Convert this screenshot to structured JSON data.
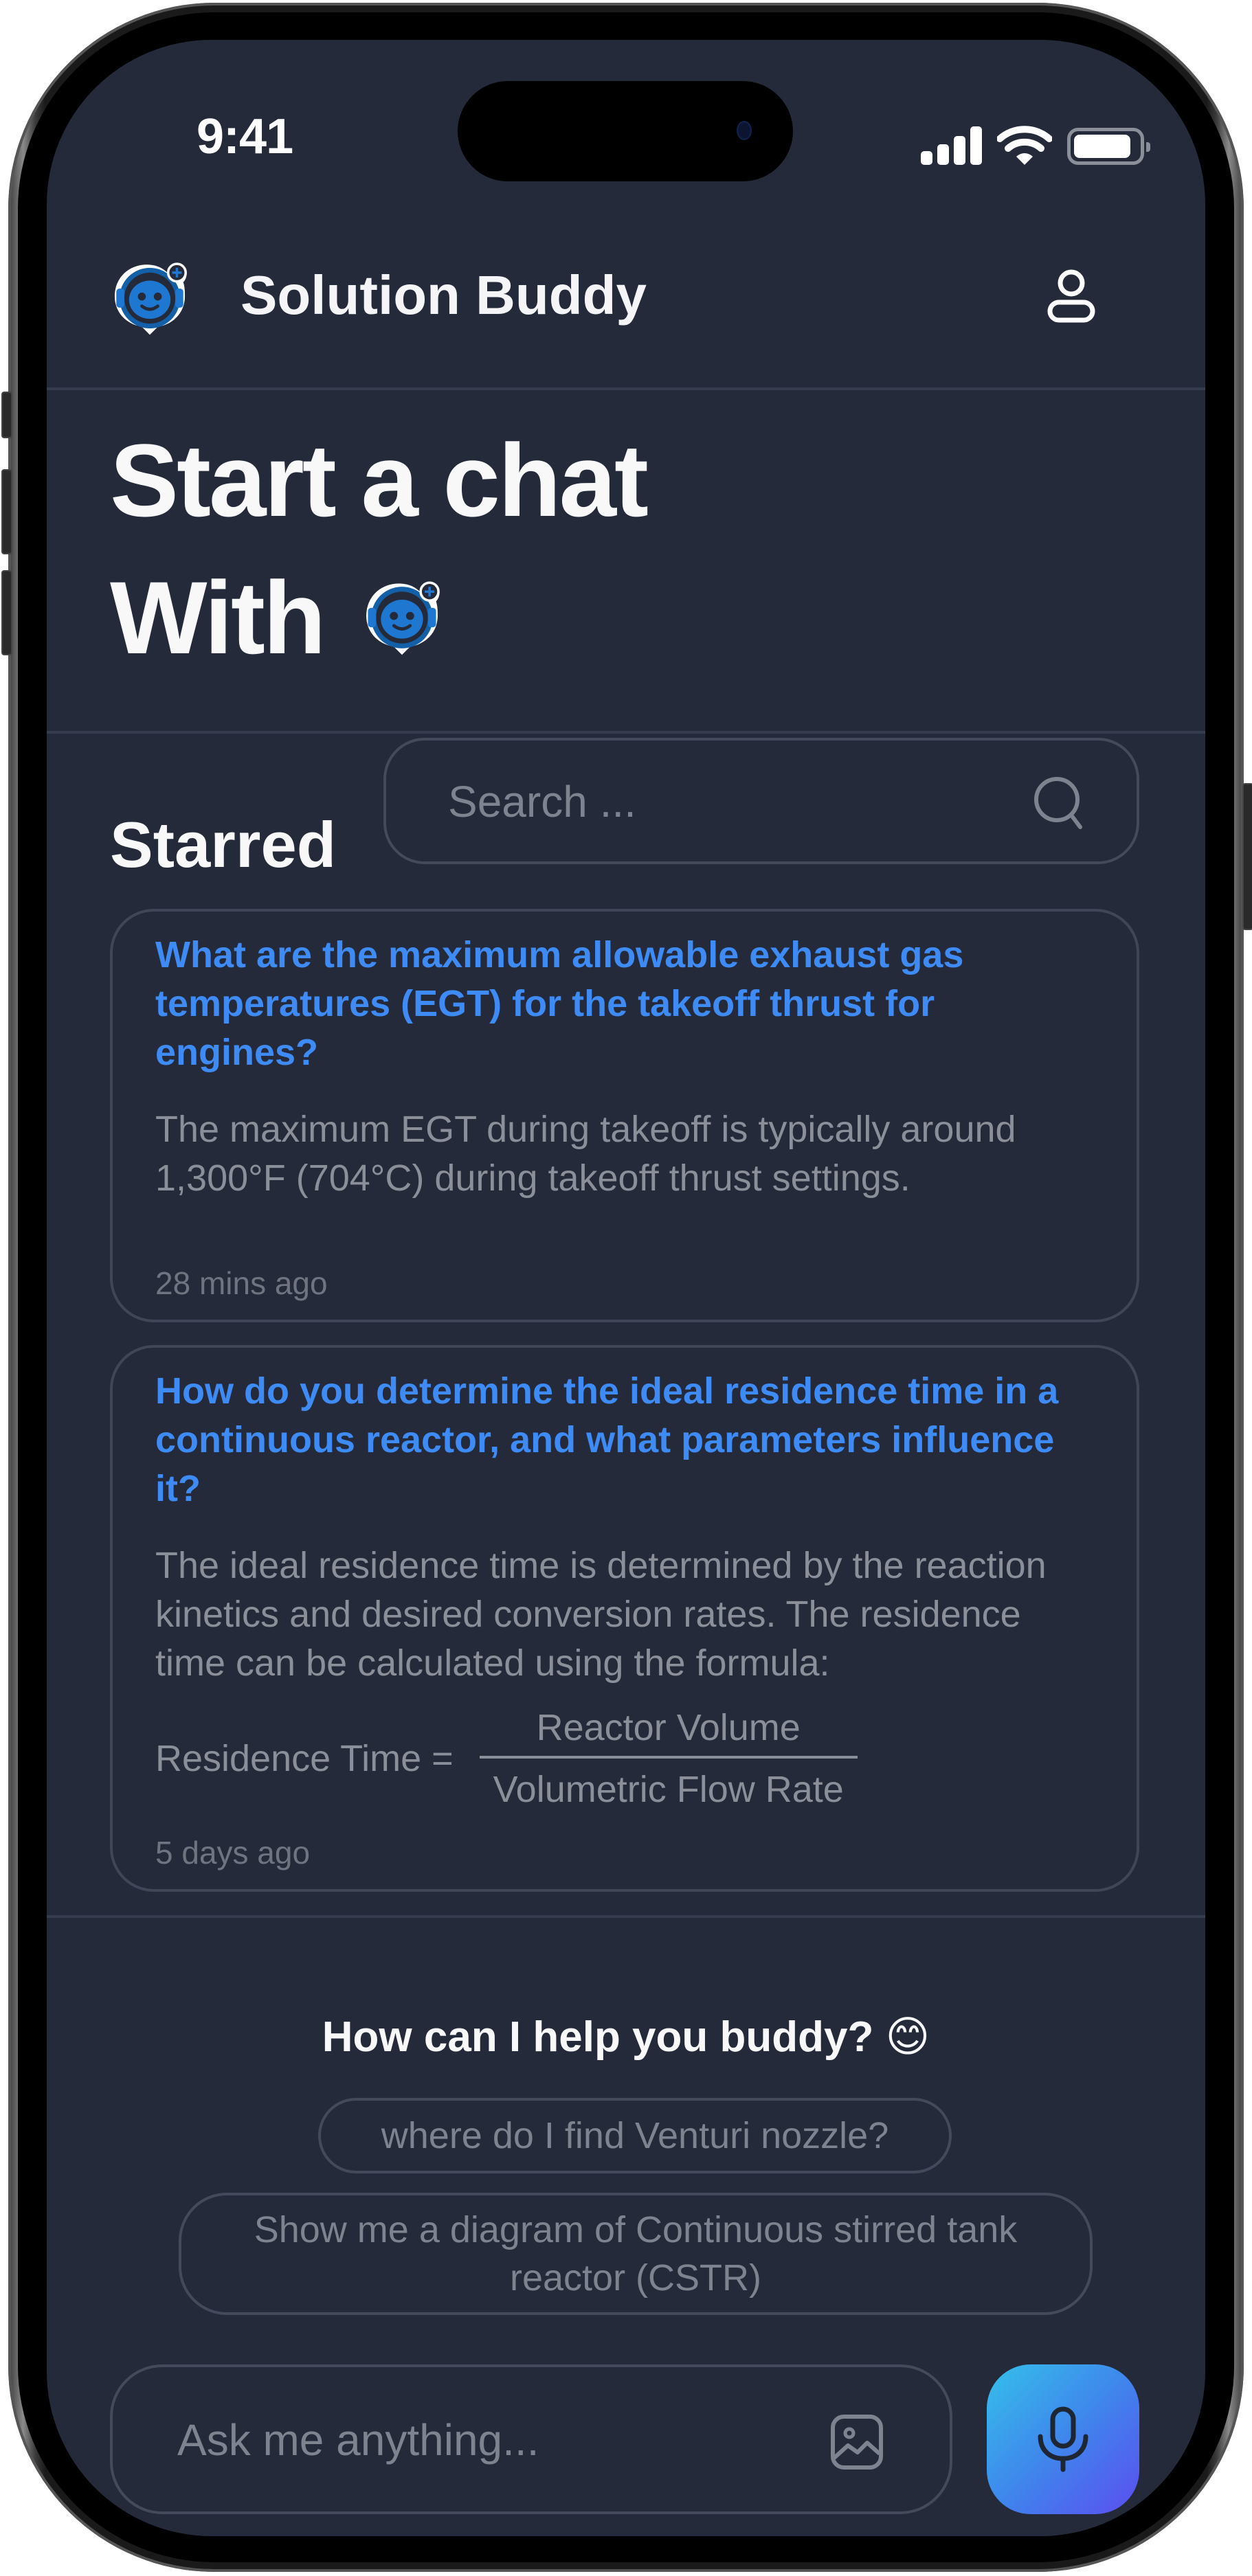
{
  "status_bar": {
    "time": "9:41",
    "signal_bars": 4,
    "wifi": "full",
    "battery_level": 0.85
  },
  "header": {
    "title": "Solution Buddy",
    "logo_icon": "robot-chat-logo",
    "profile_icon": "user-icon"
  },
  "hero": {
    "line1": "Start a chat",
    "line2": "With",
    "inline_icon": "robot-chat-logo"
  },
  "starred": {
    "label": "Starred",
    "search_placeholder": "Search ...",
    "search_value": "",
    "search_icon": "search-icon",
    "items": [
      {
        "question": "What are the maximum allowable exhaust gas temperatures (EGT) for the takeoff thrust for engines?",
        "answer": "The maximum EGT during takeoff is typically around 1,300°F (704°C) during takeoff thrust settings.",
        "time": "28 mins ago"
      },
      {
        "question": "How do you determine the ideal residence time in a continuous reactor, and what parameters influence it?",
        "answer": "The ideal residence time is determined by the reaction kinetics and desired conversion rates. The residence time can be calculated using the formula:",
        "formula": {
          "lhs": "Residence Time =",
          "numerator": "Reactor Volume",
          "denominator": "Volumetric Flow Rate"
        },
        "time": "5 days ago"
      }
    ]
  },
  "assistant": {
    "prompt": "How can I help you buddy? 😊",
    "suggestions": [
      "where do I find Venturi nozzle?",
      "Show me a diagram of Continuous stirred tank reactor (CSTR)"
    ],
    "input_placeholder": "Ask me anything...",
    "input_value": "",
    "image_icon": "image-icon",
    "mic_icon": "microphone-icon"
  },
  "colors": {
    "background": "#242a3a",
    "divider": "#363d4f",
    "accent_blue": "#3e8bf5",
    "muted_text": "#8b8f99",
    "mic_gradient_start": "#35c0ea",
    "mic_gradient_end": "#5b4ef0"
  }
}
